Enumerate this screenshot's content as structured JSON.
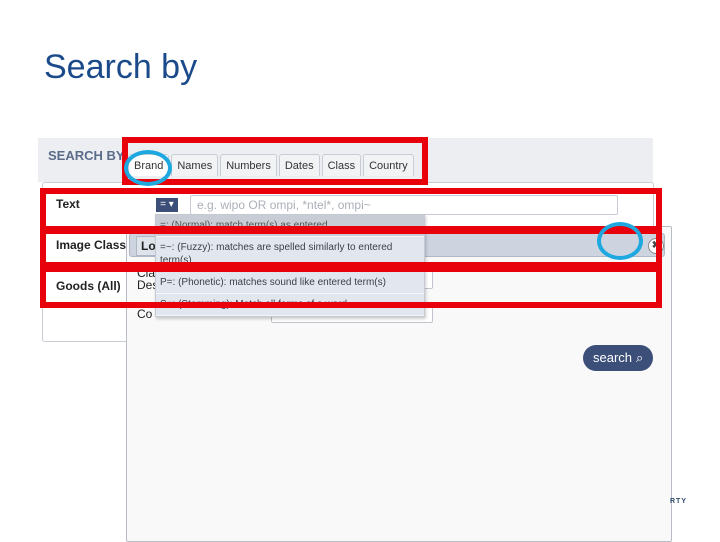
{
  "slide": {
    "title": "Search by"
  },
  "search_panel": {
    "label": "SEARCH BY",
    "tabs": [
      {
        "label": "Brand",
        "active": true
      },
      {
        "label": "Names",
        "active": false
      },
      {
        "label": "Numbers",
        "active": false
      },
      {
        "label": "Dates",
        "active": false
      },
      {
        "label": "Class",
        "active": false
      },
      {
        "label": "Country",
        "active": false
      }
    ]
  },
  "form": {
    "rows": [
      {
        "label": "Text"
      },
      {
        "label": "Image Class"
      },
      {
        "label": "Goods (All)"
      }
    ],
    "operator_button": "= ▾",
    "text_input_placeholder": "e.g. wipo OR ompi, *ntel*, ompi~"
  },
  "operator_dropdown": {
    "items": [
      {
        "label": "=: (Normal): match term(s) as entered",
        "selected": true
      },
      {
        "label": "=~: (Fuzzy): matches are spelled similarly to entered term(s)",
        "selected": false
      },
      {
        "label": "P=: (Phonetic): matches sound like entered term(s)",
        "selected": false
      },
      {
        "label": "S=: (Stemming): Match all forms of a word.",
        "selected": false
      }
    ]
  },
  "modal": {
    "tab_label": "Lo",
    "close_icon": "✖",
    "class_label_line1": "Cla",
    "class_label_line2": "Des",
    "code_label": "Co",
    "search_button": "search",
    "search_icon": "⌕"
  },
  "footer": {
    "logo_fragment": "RTY"
  },
  "annotation_colors": {
    "red": "#e8000b",
    "blue": "#1fa8e0"
  }
}
